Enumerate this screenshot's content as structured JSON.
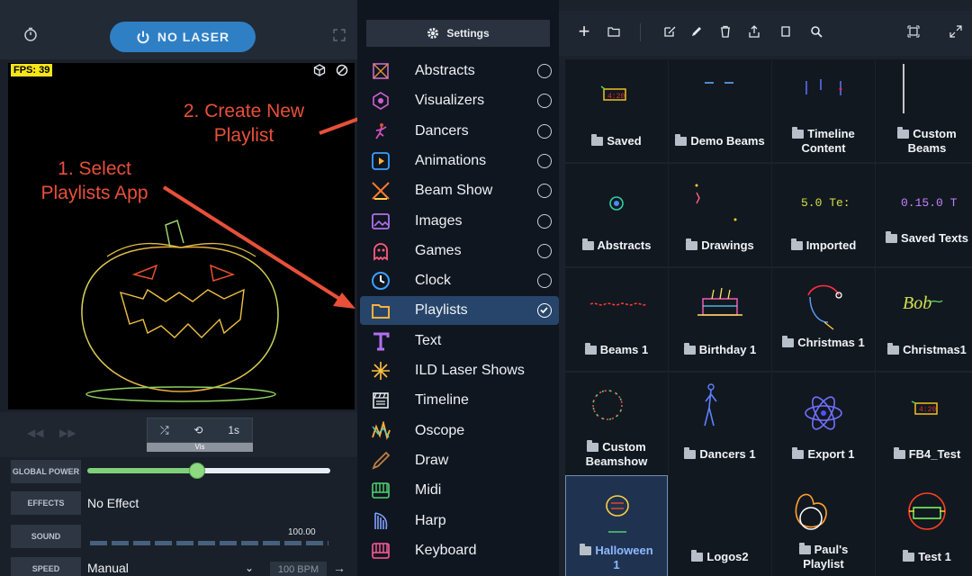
{
  "left": {
    "power_label": "NO LASER",
    "fps": "FPS: 39",
    "annotation_select": "1. Select\nPlaylists App",
    "annotation_create": "2. Create New\nPlaylist",
    "loop_time": "1s",
    "vis_label": "Vis",
    "controls": {
      "global_power_label": "GLOBAL POWER",
      "global_power_level": 0.45,
      "effects_label": "EFFECTS",
      "effects_value": "No Effect",
      "sound_label": "SOUND",
      "sound_value": "100.00",
      "speed_label": "SPEED",
      "speed_value": "Manual",
      "bpm": "100 BPM"
    }
  },
  "middle": {
    "settings_label": "Settings",
    "apps": [
      {
        "label": "Abstracts",
        "icon": "abstracts-icon",
        "radio": true
      },
      {
        "label": "Visualizers",
        "icon": "visualizers-icon",
        "radio": true
      },
      {
        "label": "Dancers",
        "icon": "dancers-icon",
        "radio": true
      },
      {
        "label": "Animations",
        "icon": "animations-icon",
        "radio": true
      },
      {
        "label": "Beam Show",
        "icon": "beam-show-icon",
        "radio": true
      },
      {
        "label": "Images",
        "icon": "images-icon",
        "radio": true
      },
      {
        "label": "Games",
        "icon": "games-icon",
        "radio": true
      },
      {
        "label": "Clock",
        "icon": "clock-icon",
        "radio": true
      },
      {
        "label": "Playlists",
        "icon": "playlists-icon",
        "radio": true,
        "selected": true
      },
      {
        "label": "Text",
        "icon": "text-icon",
        "radio": false
      },
      {
        "label": "ILD Laser Shows",
        "icon": "ild-icon",
        "radio": false
      },
      {
        "label": "Timeline",
        "icon": "timeline-icon",
        "radio": false
      },
      {
        "label": "Oscope",
        "icon": "oscope-icon",
        "radio": false
      },
      {
        "label": "Draw",
        "icon": "draw-icon",
        "radio": false
      },
      {
        "label": "Midi",
        "icon": "midi-icon",
        "radio": false
      },
      {
        "label": "Harp",
        "icon": "harp-icon",
        "radio": false
      },
      {
        "label": "Keyboard",
        "icon": "keyboard-icon",
        "radio": false
      }
    ]
  },
  "right": {
    "tiles": [
      {
        "label": "Saved"
      },
      {
        "label": "Demo Beams"
      },
      {
        "label": "Timeline Content"
      },
      {
        "label": "Custom Beams"
      },
      {
        "label": "Abstracts"
      },
      {
        "label": "Drawings"
      },
      {
        "label": "Imported"
      },
      {
        "label": "Saved Texts"
      },
      {
        "label": "Beams 1"
      },
      {
        "label": "Birthday 1"
      },
      {
        "label": "Christmas 1"
      },
      {
        "label": "Christmas1"
      },
      {
        "label": "Custom Beamshow"
      },
      {
        "label": "Dancers 1"
      },
      {
        "label": "Export 1"
      },
      {
        "label": "FB4_Test"
      },
      {
        "label": "Halloween 1",
        "selected": true
      },
      {
        "label": "Logos2"
      },
      {
        "label": "Paul's Playlist"
      },
      {
        "label": "Test 1"
      }
    ],
    "thumb_texts": {
      "imported": "5.0 Te:",
      "saved_texts": "0.15.0 T"
    }
  },
  "colors": {
    "accent_blue": "#2f7fc4",
    "annotation_red": "#e8503a",
    "fps_yellow": "#f7e51a",
    "power_green": "#7fd07a"
  }
}
